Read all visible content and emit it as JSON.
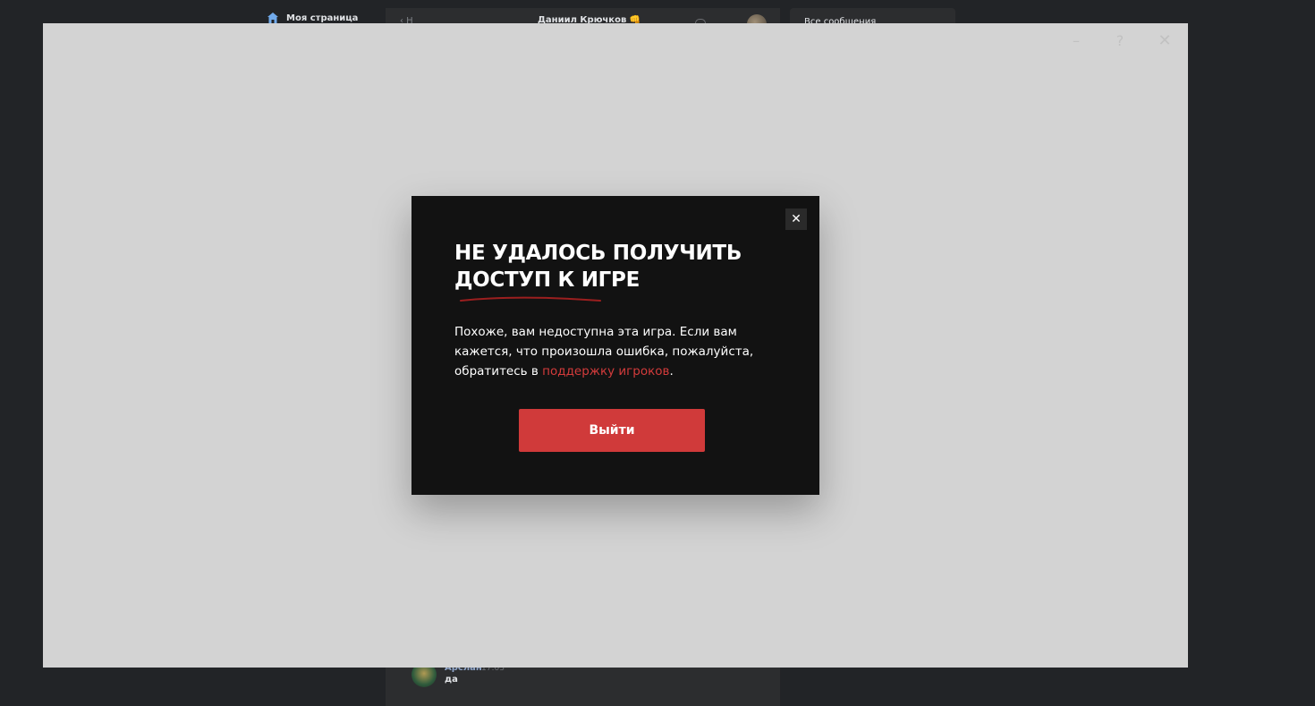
{
  "background_page": {
    "sidebar": {
      "my_page_label": "Моя страница"
    },
    "chat": {
      "back_label": "‹ Н",
      "title": "Даниил Крючков 👊",
      "messages": [
        {
          "author": "Арслан",
          "time": "17:03",
          "text": "да"
        }
      ]
    },
    "right_panel": {
      "label": "Все сообщения"
    }
  },
  "game_window": {
    "controls": {
      "minimize": "–",
      "help": "?",
      "close": "✕"
    }
  },
  "error_dialog": {
    "title_line1": "НЕ УДАЛОСЬ ПОЛУЧИТЬ",
    "title_line2": "ДОСТУП К ИГРЕ",
    "body_text": "Похоже, вам недоступна эта игра. Если вам кажется, что произошла ошибка, пожалуйста, обратитесь в ",
    "support_link": "поддержку игроков",
    "body_end": ".",
    "exit_button": "Выйти",
    "close_symbol": "✕"
  },
  "colors": {
    "page_background": "#222427",
    "game_window_background": "#d3d3d3",
    "dialog_background": "#121212",
    "accent_red": "#d03a3a"
  }
}
